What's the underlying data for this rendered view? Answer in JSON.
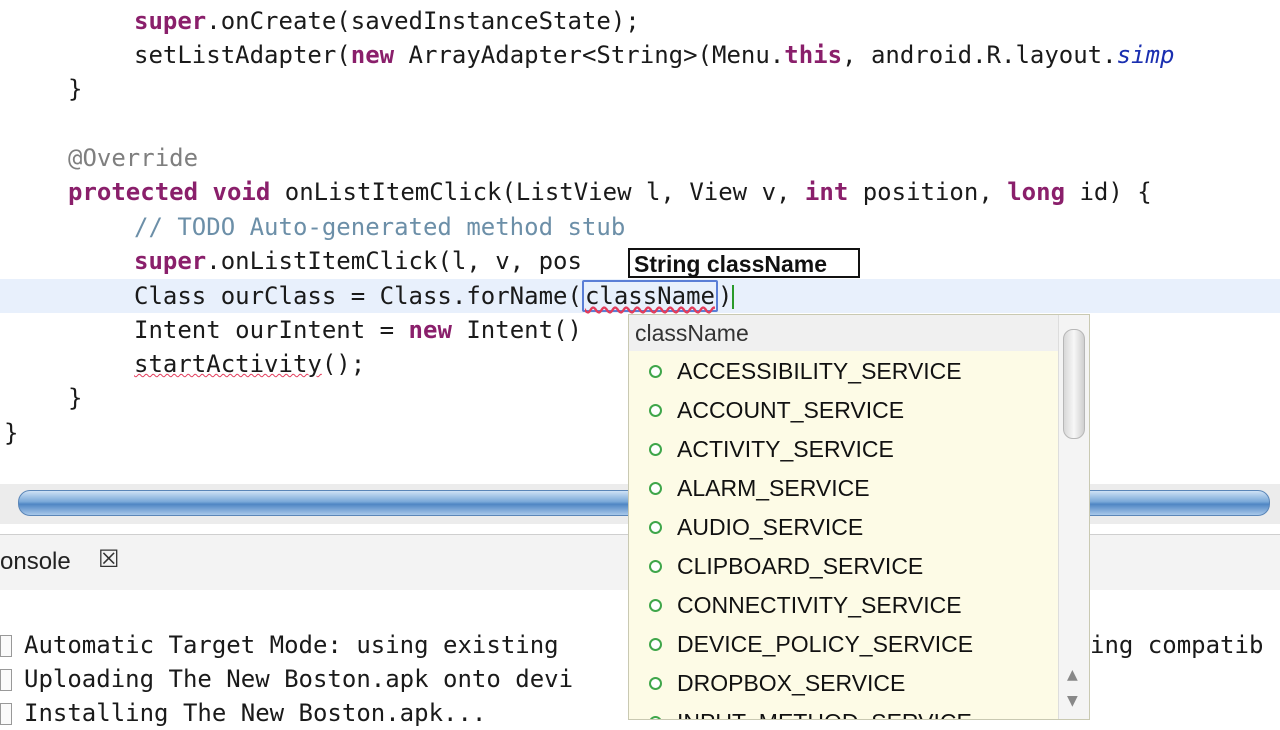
{
  "editor": {
    "line1": {
      "kw": "super",
      "rest": ".onCreate(savedInstanceState);"
    },
    "line2": {
      "a": "setListAdapter(",
      "kw": "new",
      "b": " ArrayAdapter<String>(Menu.",
      "kw2": "this",
      "c": ", android.R.layout.",
      "ital": "simp"
    },
    "line3": "}",
    "line4": "@Override",
    "line5": {
      "kw1": "protected",
      "kw2": "void",
      "a": " onListItemClick(ListView l, View v, ",
      "kw3": "int",
      "b": " position, ",
      "kw4": "long",
      "c": " id) {"
    },
    "line6": "// TODO Auto-generated method stub",
    "line7": {
      "kw": "super",
      "rest": ".onListItemClick(l, v, pos"
    },
    "line8": {
      "a": "Class ourClass = Class.forName(",
      "sel": "className",
      "b": ")"
    },
    "line9": {
      "a": "Intent ourIntent = ",
      "kw": "new",
      "b": " Intent()"
    },
    "line10": {
      "a": "startActivity",
      "b": "();"
    },
    "line11": "}",
    "line12": "}"
  },
  "hint": "String className",
  "console": {
    "tab_label": "onsole",
    "close_symbol": "☒",
    "lines": [
      "Automatic Target Mode: using existing",
      "Uploading The New Boston.apk onto devi",
      "Installing The New Boston.apk..."
    ],
    "right_fragment": "ing compatib"
  },
  "popup": {
    "header": "className",
    "items": [
      "ACCESSIBILITY_SERVICE",
      "ACCOUNT_SERVICE",
      "ACTIVITY_SERVICE",
      "ALARM_SERVICE",
      "AUDIO_SERVICE",
      "CLIPBOARD_SERVICE",
      "CONNECTIVITY_SERVICE",
      "DEVICE_POLICY_SERVICE",
      "DROPBOX_SERVICE",
      "INPUT_METHOD_SERVICE"
    ]
  },
  "colors": {
    "keyword": "#8a1f6b",
    "comment": "#6c8fa8",
    "current_line": "#e8f0fc",
    "popup_bg": "#fdfbe6",
    "field_icon": "#3fa64a"
  }
}
